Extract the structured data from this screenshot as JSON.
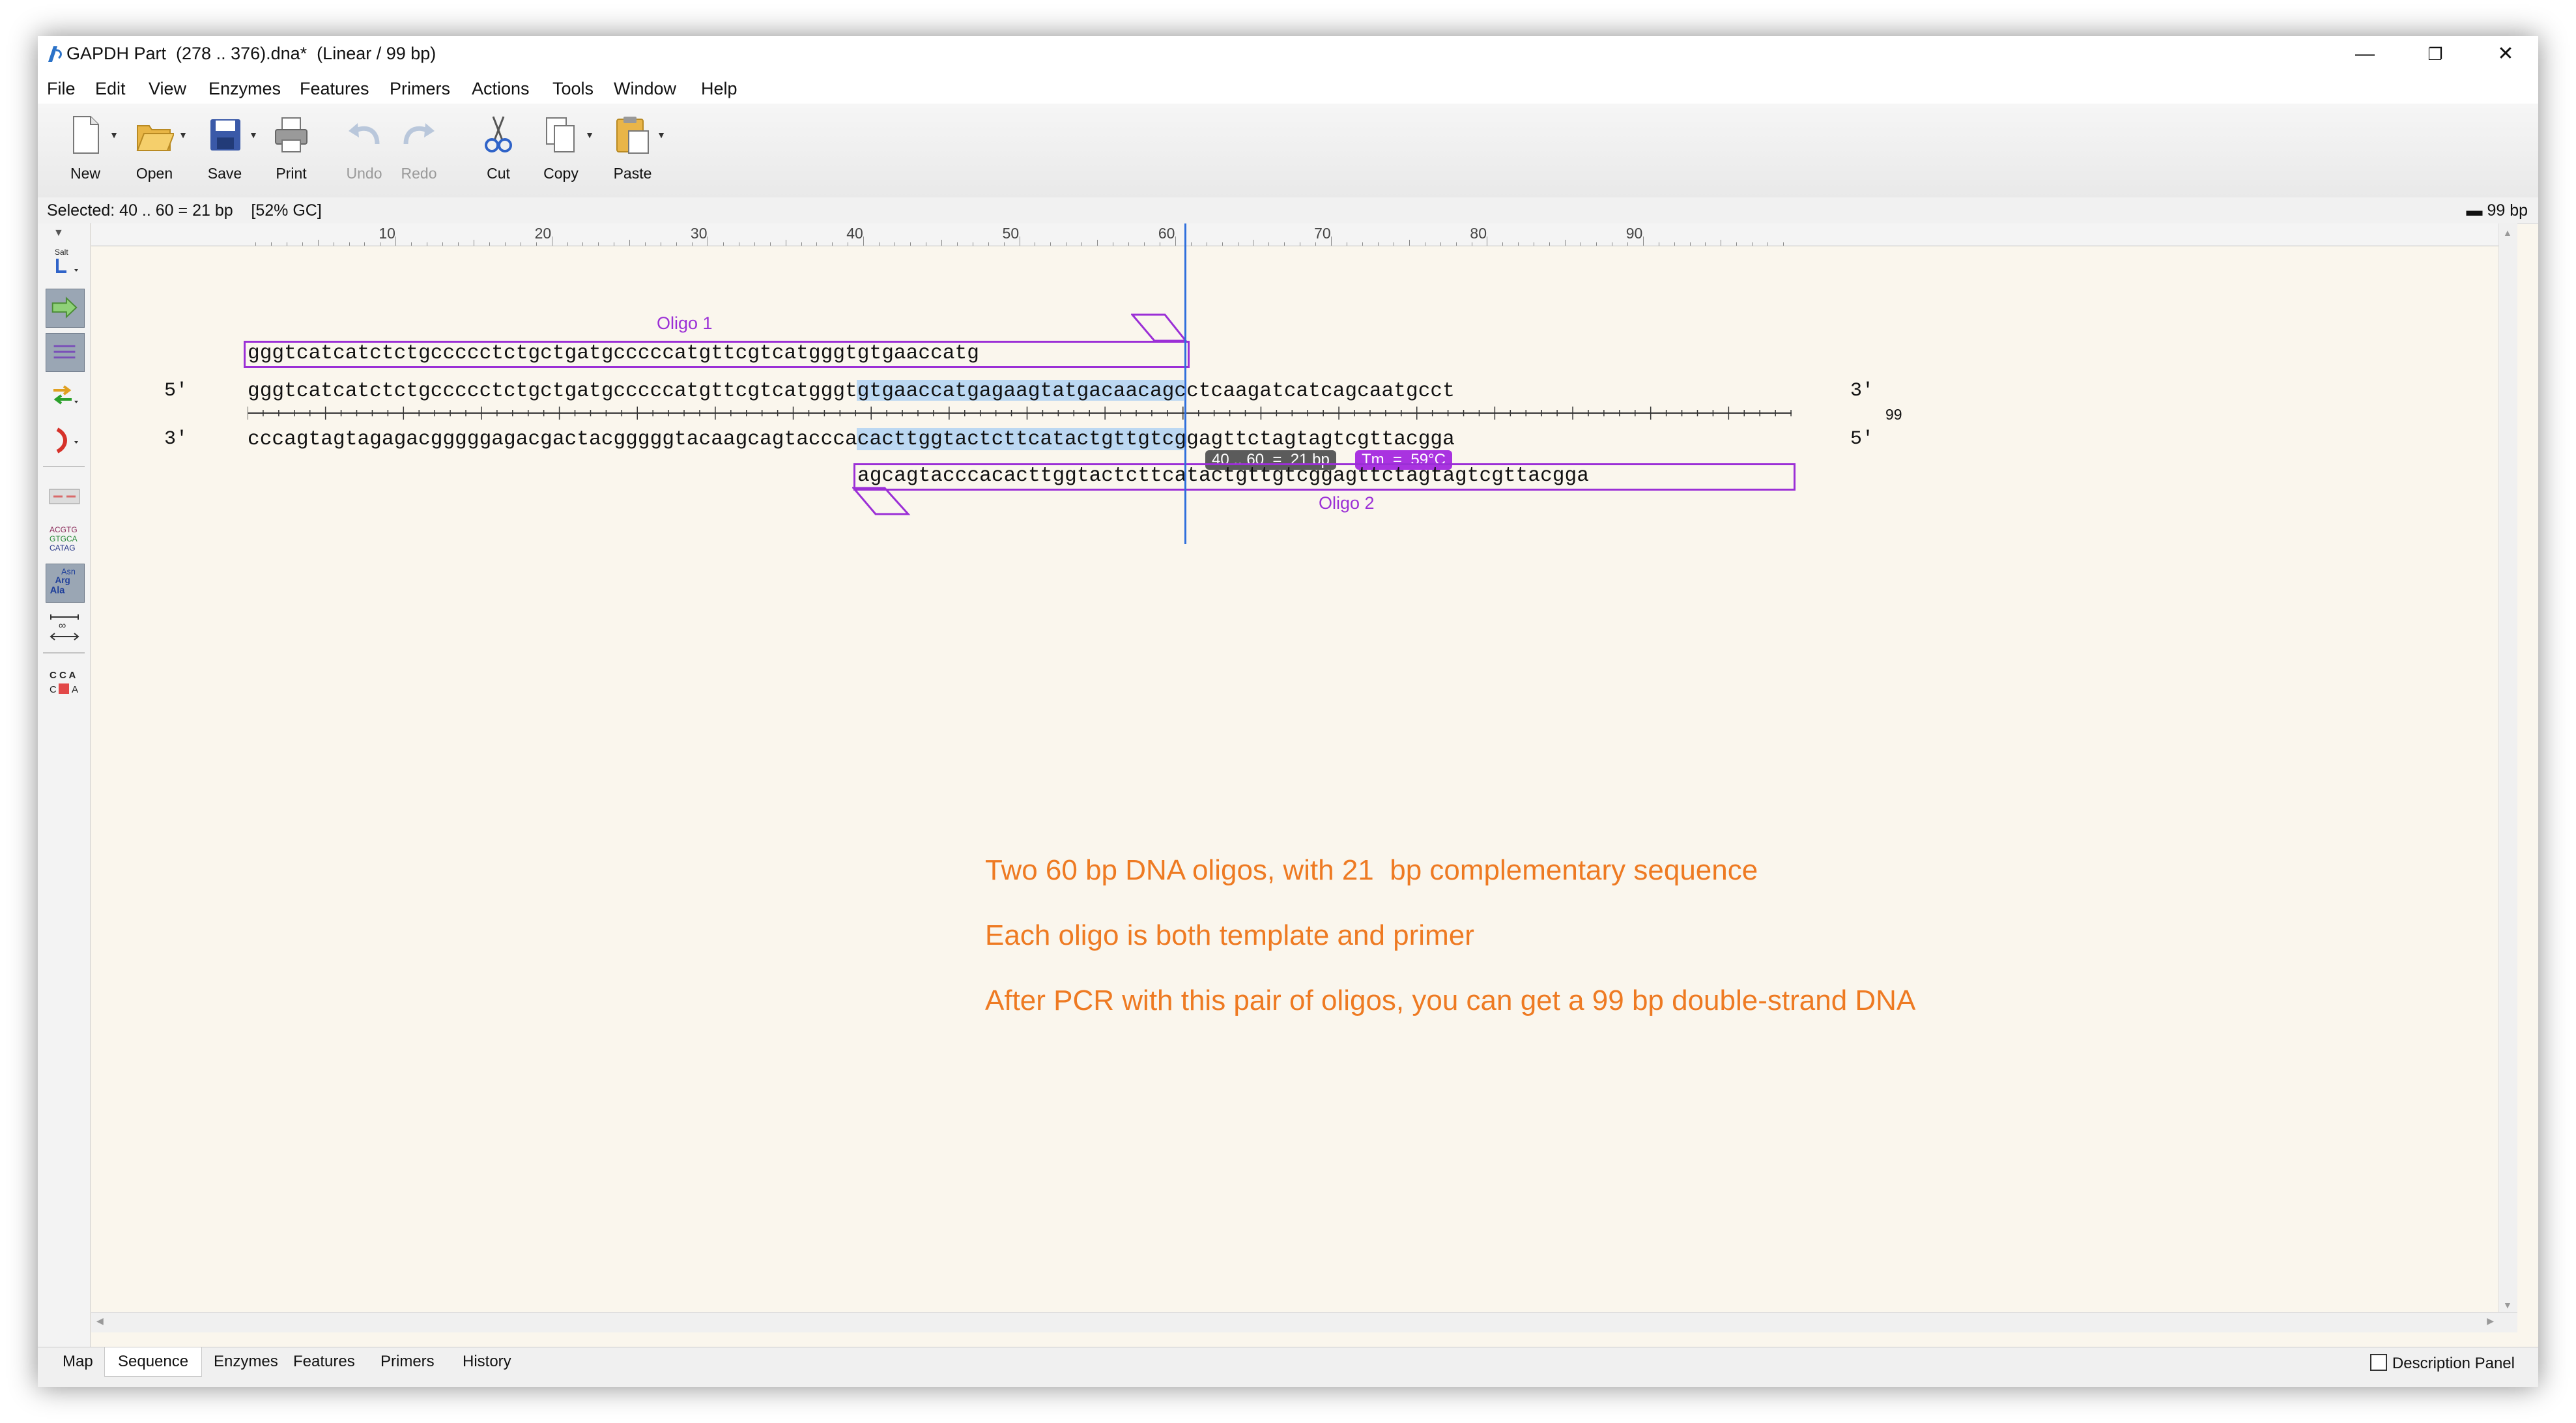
{
  "window": {
    "title": "GAPDH Part  (278 .. 376).dna*  (Linear / 99 bp)",
    "minimize_icon": "minimize-icon",
    "restore_icon": "restore-icon",
    "close_icon": "close-icon"
  },
  "menu": [
    "File",
    "Edit",
    "View",
    "Enzymes",
    "Features",
    "Primers",
    "Actions",
    "Tools",
    "Window",
    "Help"
  ],
  "toolbar": {
    "new": "New",
    "open": "Open",
    "save": "Save",
    "print": "Print",
    "undo": "Undo",
    "redo": "Redo",
    "cut": "Cut",
    "copy": "Copy",
    "paste": "Paste"
  },
  "status": {
    "selection": "Selected: 40 .. 60 = 21 bp    [52% GC]",
    "length": "99 bp"
  },
  "ruler": {
    "labels": [
      "10",
      "20",
      "30",
      "40",
      "50",
      "60",
      "70",
      "80",
      "90"
    ]
  },
  "sequence": {
    "top_strand": "gggtcatcatctctgccccctctgctgatgcccccatgttcgtcatgggtgtgaaccatgagaagtatgacaacagcctcaagatcatcagcaatgcct",
    "bottom_strand": "cccagtagtagagacgggggagacgactacgggggtacaagcagtacccacacttggtactcttcatactgttgtcggagttctagtagtcgttacgga",
    "top_left_end": "5′",
    "top_right_end": "3′",
    "bottom_left_end": "3′",
    "bottom_right_end": "5′",
    "end_position": "99",
    "selection_start": 40,
    "selection_end": 60
  },
  "oligos": {
    "oligo1_label": "Oligo 1",
    "oligo1_sequence": "gggtcatcatctctgccccctctgctgatgcccccatgttcgtcatgggtgtgaaccatg",
    "oligo2_label": "Oligo 2",
    "oligo2_sequence": "agcagtacccacacttggtactcttcatactgttgtcggagttctagtagtcgttacgga",
    "color": "#9b2fd6"
  },
  "tooltip": {
    "range": "40 .. 60  =  21 bp",
    "tm": "Tm  =  59°C"
  },
  "notes": [
    "Two 60 bp DNA oligos, with 21  bp complementary sequence",
    "Each oligo is both template and primer",
    "After PCR with this pair of oligos, you can get a 99 bp double-strand DNA"
  ],
  "tabs": [
    "Map",
    "Sequence",
    "Enzymes",
    "Features",
    "Primers",
    "History"
  ],
  "active_tab": "Sequence",
  "description_panel": "Description Panel",
  "colors": {
    "selection": "#bcd8f2",
    "oligo": "#9b2fd6",
    "note": "#ee7a22",
    "cursor": "#2f6fdc",
    "background": "#faf6ed"
  }
}
